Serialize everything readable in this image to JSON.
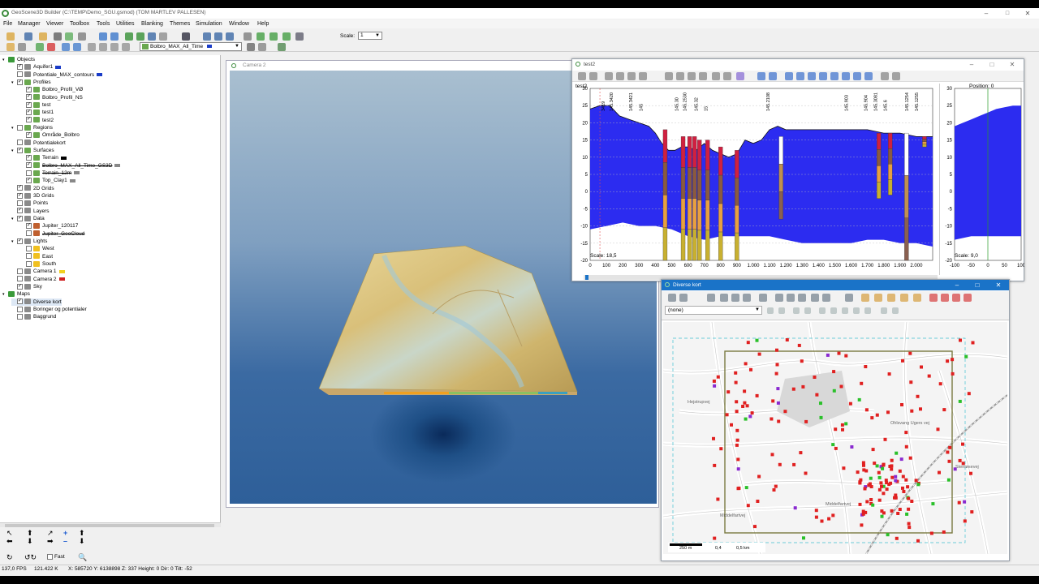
{
  "window": {
    "title": "GeoScene3D Builder (C:\\TEMP\\Demo_SGU.gsmod) (TOM MARTLEV PALLESEN)"
  },
  "menu": [
    "File",
    "Manager",
    "Viewer",
    "Toolbox",
    "Tools",
    "Utilities",
    "Blanking",
    "Themes",
    "Simulation",
    "Window",
    "Help"
  ],
  "toolbar": {
    "scale_label": "Scale:",
    "scale_value": "1",
    "theme_select": "Bolbro_MAX_All_Time",
    "theme_color": "#1a3cc8"
  },
  "tree": [
    {
      "depth": 0,
      "check": null,
      "label": "Objects",
      "icon": "folder-icon"
    },
    {
      "depth": 1,
      "check": true,
      "label": "Aquifer1",
      "color": "#1a3cc8",
      "icon": "aquifer-icon"
    },
    {
      "depth": 1,
      "check": false,
      "label": "Potentiale_MAX_contours",
      "color": "#1a3cc8",
      "icon": "contour-icon"
    },
    {
      "depth": 1,
      "check": true,
      "label": "Profiles",
      "icon": "profiles-icon",
      "group": true
    },
    {
      "depth": 2,
      "check": true,
      "label": "Bolbro_Profil_VØ",
      "icon": "profile-icon"
    },
    {
      "depth": 2,
      "check": true,
      "label": "Bolbro_Profil_NS",
      "icon": "profile-icon"
    },
    {
      "depth": 2,
      "check": true,
      "label": "test",
      "icon": "profile-icon"
    },
    {
      "depth": 2,
      "check": true,
      "label": "test1",
      "icon": "profile-icon"
    },
    {
      "depth": 2,
      "check": true,
      "label": "test2",
      "icon": "profile-icon"
    },
    {
      "depth": 1,
      "check": false,
      "label": "Regions",
      "icon": "regions-icon",
      "group": true
    },
    {
      "depth": 2,
      "check": true,
      "label": "Område_Bolbro",
      "icon": "region-icon"
    },
    {
      "depth": 1,
      "check": false,
      "label": "Potentialekort",
      "icon": "map-icon"
    },
    {
      "depth": 1,
      "check": true,
      "label": "Surfaces",
      "icon": "surfaces-icon",
      "group": true
    },
    {
      "depth": 2,
      "check": true,
      "label": "Terrain",
      "color": "#000000",
      "icon": "surface-icon"
    },
    {
      "depth": 2,
      "check": true,
      "label": "Bolbro_MAX_All_Time_GS3D",
      "color": "#888888",
      "icon": "surface-icon",
      "strike": true
    },
    {
      "depth": 2,
      "check": false,
      "label": "Terrain_12m",
      "color": "#888888",
      "icon": "surface-icon",
      "strike": true
    },
    {
      "depth": 2,
      "check": true,
      "label": "Top_Clay1",
      "color": "#888888",
      "icon": "surface-icon"
    },
    {
      "depth": 1,
      "check": true,
      "label": "2D Grids",
      "icon": "grid-icon"
    },
    {
      "depth": 1,
      "check": true,
      "label": "3D Grids",
      "icon": "grid-icon"
    },
    {
      "depth": 1,
      "check": false,
      "label": "Points",
      "icon": "points-icon"
    },
    {
      "depth": 1,
      "check": true,
      "label": "Layers",
      "icon": "layers-icon"
    },
    {
      "depth": 1,
      "check": true,
      "label": "Data",
      "icon": "data-icon",
      "group": true
    },
    {
      "depth": 2,
      "check": true,
      "label": "Jupiter_120117",
      "icon": "borehole-icon"
    },
    {
      "depth": 2,
      "check": false,
      "label": "Jupiter_GeoCloud",
      "icon": "borehole-icon",
      "strike": true
    },
    {
      "depth": 1,
      "check": true,
      "label": "Lights",
      "icon": "lights-icon",
      "group": true
    },
    {
      "depth": 2,
      "check": false,
      "label": "West",
      "icon": "sun-icon"
    },
    {
      "depth": 2,
      "check": false,
      "label": "East",
      "icon": "sun-icon"
    },
    {
      "depth": 2,
      "check": false,
      "label": "South",
      "icon": "sun-icon"
    },
    {
      "depth": 1,
      "check": false,
      "label": "Camera 1",
      "color": "#f0d020",
      "icon": "camera-icon"
    },
    {
      "depth": 1,
      "check": false,
      "label": "Camera 2",
      "color": "#d02020",
      "icon": "camera-icon"
    },
    {
      "depth": 1,
      "check": true,
      "label": "Sky",
      "icon": "sky-icon"
    },
    {
      "depth": 0,
      "check": null,
      "label": "Maps",
      "icon": "maps-icon"
    },
    {
      "depth": 1,
      "check": true,
      "label": "Diverse kort",
      "icon": "map-layer-icon",
      "selected": true
    },
    {
      "depth": 1,
      "check": false,
      "label": "Boringer og potentialer",
      "icon": "map-layer-icon"
    },
    {
      "depth": 1,
      "check": false,
      "label": "Baggrund",
      "icon": "map-layer-icon"
    }
  ],
  "nav": {
    "fast_label": "Fast"
  },
  "camera": {
    "title": "Camera 2"
  },
  "profile": {
    "title": "test2",
    "profile_name": "test2",
    "scale": "Scale: 18,5",
    "x_ticks": [
      "0",
      "100",
      "200",
      "300",
      "400",
      "500",
      "600",
      "700",
      "800",
      "900",
      "1.000",
      "1.100",
      "1.200",
      "1.300",
      "1.400",
      "1.500",
      "1.600",
      "1.700",
      "1.800",
      "1.900",
      "2.000"
    ],
    "y_ticks": [
      "30",
      "25",
      "20",
      "15",
      "10",
      "5",
      "0",
      "-5",
      "-10",
      "-15",
      "-20"
    ],
    "borehole_labels": [
      "3419",
      "145.3420",
      "145.3421",
      "145",
      "145.30",
      "145.2530",
      "145.32",
      "15",
      "145.2108",
      "145.903",
      "145.904",
      "145.3081",
      "145.6",
      "145.1254",
      "145.1255"
    ]
  },
  "position": {
    "title": "Position: 0",
    "scale": "Scale: 9,0",
    "x_ticks": [
      "-100",
      "-50",
      "0",
      "50",
      "100"
    ],
    "y_ticks": [
      "30",
      "25",
      "20",
      "15",
      "10",
      "5",
      "0",
      "-5",
      "-10",
      "-15",
      "-20"
    ]
  },
  "mapwin": {
    "title": "Diverse kort",
    "layer_select": "(none)",
    "scalebar": [
      "250 m",
      "0,4",
      "0,5 km"
    ],
    "streets": [
      "Hejstrupvej",
      "Middelfartvej",
      "Middelfartvej",
      "Ohlsvang Ugers vej",
      "Stenløsevej"
    ]
  },
  "status": {
    "fps": "137,0 FPS",
    "memory": "121.422 K",
    "coords": "X: 585720  Y: 6138898  Z: 337  Height: 0  Dir: 0  Tilt: -52"
  }
}
